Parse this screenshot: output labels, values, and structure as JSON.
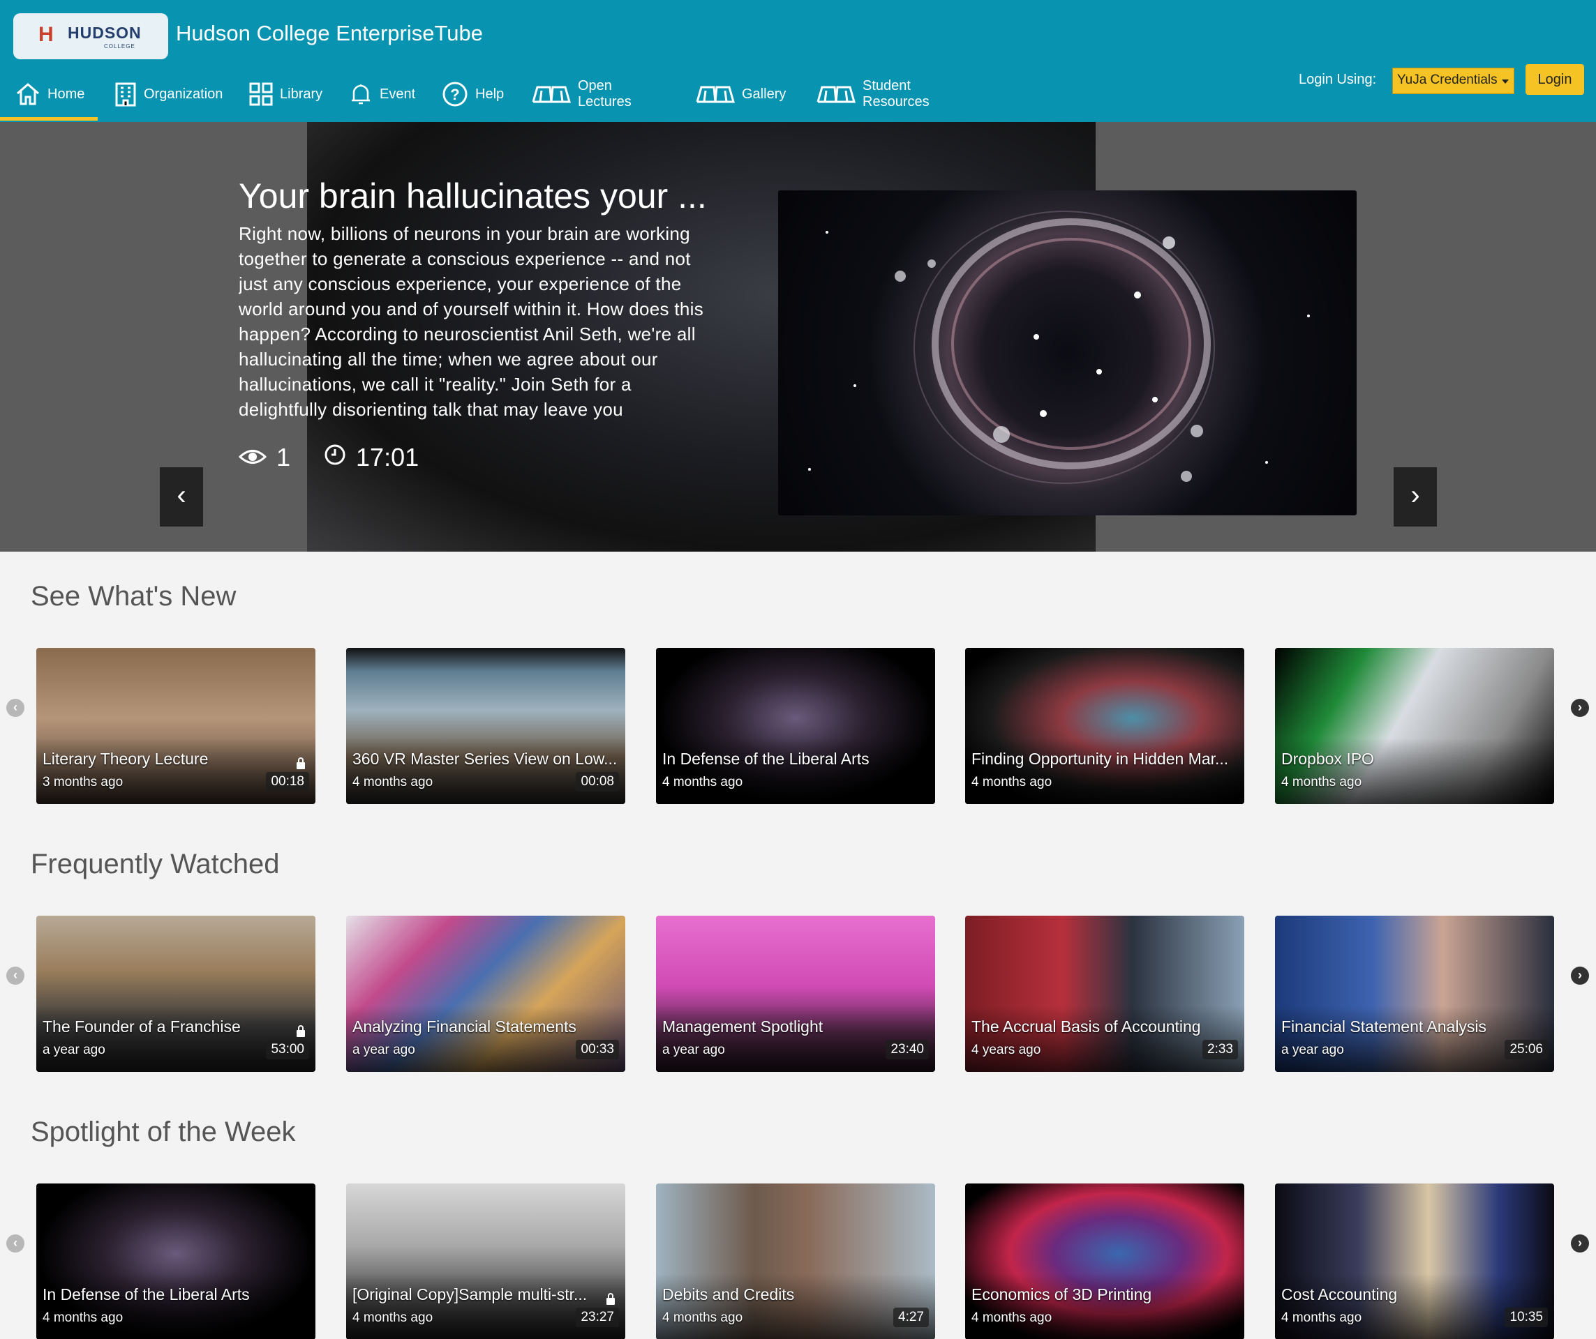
{
  "header": {
    "logo_text": "HUDSON",
    "logo_sub": "COLLEGE",
    "site_title": "Hudson College EnterpriseTube",
    "nav": [
      {
        "label": "Home",
        "icon": "home-icon"
      },
      {
        "label": "Organization",
        "icon": "building-icon"
      },
      {
        "label": "Library",
        "icon": "grid-icon"
      },
      {
        "label": "Event",
        "icon": "bell-icon"
      },
      {
        "label": "Help",
        "icon": "help-icon"
      },
      {
        "label": "Open Lectures",
        "icon": "book-icon"
      },
      {
        "label": "Gallery",
        "icon": "book-icon"
      },
      {
        "label": "Student Resources",
        "icon": "book-icon"
      }
    ],
    "active_nav": "Home",
    "login_label": "Login Using:",
    "login_option": "YuJa Credentials",
    "login_button": "Login"
  },
  "hero": {
    "title": "Your brain hallucinates your ...",
    "description": "Right now, billions of neurons in your brain are working together to generate a conscious experience -- and not just any conscious experience, your experience of the world around you and of yourself within it. How does this happen? According to neuroscientist Anil Seth, we're all hallucinating all the time; when we agree about our hallucinations, we call it \"reality.\" Join Seth for a delightfully disorienting talk that may leave you questioning the very nature of your",
    "views": "1",
    "duration": "17:01",
    "prev": "‹",
    "next": "›"
  },
  "sections": [
    {
      "title": "See What's New",
      "cards": [
        {
          "title": "Literary Theory Lecture",
          "age": "3 months ago",
          "duration": "00:18",
          "locked": true
        },
        {
          "title": "360 VR Master Series View on Low...",
          "age": "4 months ago",
          "duration": "00:08",
          "locked": false
        },
        {
          "title": "In Defense of the Liberal Arts",
          "age": "4 months ago",
          "duration": "",
          "locked": false
        },
        {
          "title": "Finding Opportunity in Hidden Mar...",
          "age": "4 months ago",
          "duration": "",
          "locked": false
        },
        {
          "title": "Dropbox IPO",
          "age": "4 months ago",
          "duration": "",
          "locked": false
        }
      ]
    },
    {
      "title": "Frequently Watched",
      "cards": [
        {
          "title": "The Founder of a Franchise",
          "age": "a year ago",
          "duration": "53:00",
          "locked": true
        },
        {
          "title": "Analyzing Financial Statements",
          "age": "a year ago",
          "duration": "00:33",
          "locked": false
        },
        {
          "title": "Management Spotlight",
          "age": "a year ago",
          "duration": "23:40",
          "locked": false
        },
        {
          "title": "The Accrual Basis of Accounting",
          "age": "4 years ago",
          "duration": "2:33",
          "locked": false
        },
        {
          "title": "Financial Statement Analysis",
          "age": "a year ago",
          "duration": "25:06",
          "locked": false
        }
      ]
    },
    {
      "title": "Spotlight of the Week",
      "cards": [
        {
          "title": "In Defense of the Liberal Arts",
          "age": "4 months ago",
          "duration": "",
          "locked": false
        },
        {
          "title": "[Original Copy]Sample multi-str...",
          "age": "4 months ago",
          "duration": "23:27",
          "locked": true
        },
        {
          "title": "Debits and Credits",
          "age": "4 months ago",
          "duration": "4:27",
          "locked": false
        },
        {
          "title": "Economics of 3D Printing",
          "age": "4 months ago",
          "duration": "",
          "locked": false
        },
        {
          "title": "Cost Accounting",
          "age": "4 months ago",
          "duration": "10:35",
          "locked": false
        }
      ]
    }
  ],
  "colors": {
    "header": "#0894b1",
    "accent": "#f5c324",
    "page_bg": "#f3f3f3"
  }
}
